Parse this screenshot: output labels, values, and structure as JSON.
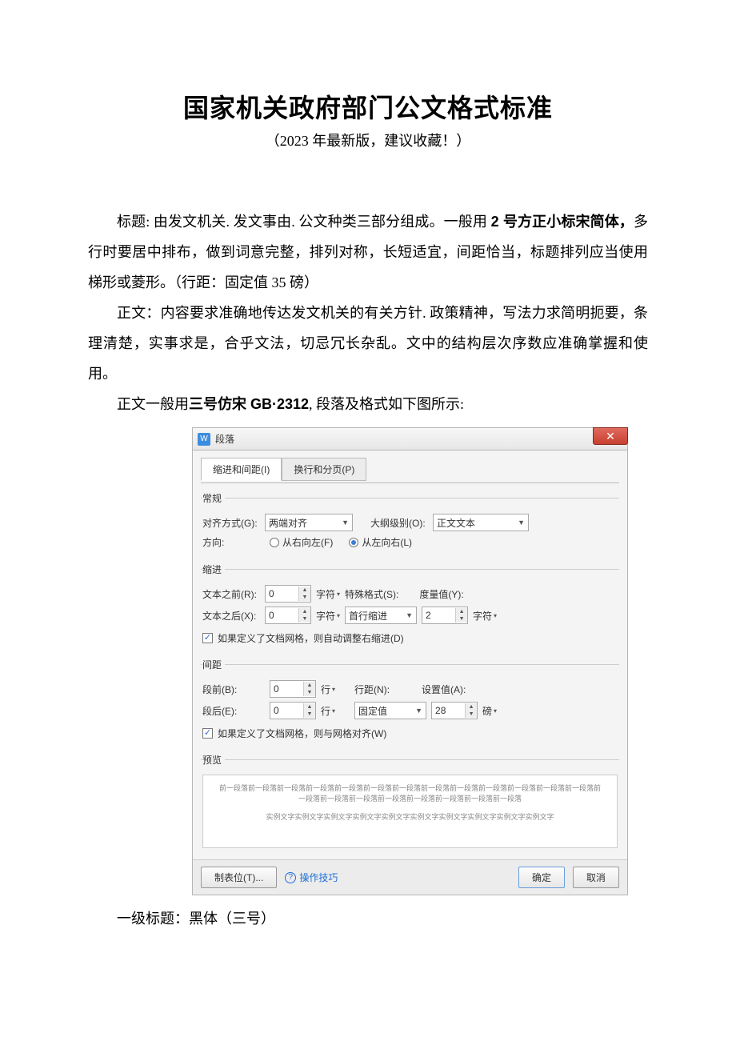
{
  "doc": {
    "title": "国家机关政府部门公文格式标准",
    "subtitle": "（2023 年最新版，建议收藏！）",
    "p1_a": "标题:",
    "p1_b": " 由发文机关. 发文事由. 公文种类三部分组成。一般用 ",
    "p1_bold1": "2 号方正小标宋简体，",
    "p1_c": "多行时要居中排布，做到词意完整，排列对称，长短适宜，间距恰当，标题排列应当使用梯形或菱形。（行距：固定值 35 磅）",
    "p2": "正文：内容要求准确地传达发文机关的有关方针. 政策精神，写法力求简明扼要，条理清楚，实事求是，合乎文法，切忌冗长杂乱。文中的结构层次序数应准确掌握和使用。",
    "p3_a": "正文一般用",
    "p3_bold": "三号仿宋 GB·2312",
    "p3_b": ", 段落及格式如下图所示:",
    "p4": "一级标题：黑体（三号）"
  },
  "dialog": {
    "title": "段落",
    "close": "✕",
    "tabs": {
      "indent": "缩进和间距(I)",
      "pagebreak": "换行和分页(P)"
    },
    "groups": {
      "general": {
        "legend": "常规",
        "align_label": "对齐方式(G):",
        "align_value": "两端对齐",
        "outline_label": "大纲级别(O):",
        "outline_value": "正文文本",
        "dir_label": "方向:",
        "dir_rtl": "从右向左(F)",
        "dir_ltr": "从左向右(L)"
      },
      "indent": {
        "legend": "缩进",
        "before_label": "文本之前(R):",
        "before_value": "0",
        "after_label": "文本之后(X):",
        "after_value": "0",
        "unit_char": "字符",
        "special_label": "特殊格式(S):",
        "special_value": "首行缩进",
        "measure_label": "度量值(Y):",
        "measure_value": "2",
        "chk_grid": "如果定义了文档网格，则自动调整右缩进(D)"
      },
      "spacing": {
        "legend": "间距",
        "before_label": "段前(B):",
        "before_value": "0",
        "after_label": "段后(E):",
        "after_value": "0",
        "unit_line": "行",
        "linespacing_label": "行距(N):",
        "linespacing_value": "固定值",
        "setat_label": "设置值(A):",
        "setat_value": "28",
        "unit_pt": "磅",
        "chk_snap": "如果定义了文档网格，则与网格对齐(W)"
      },
      "preview": {
        "legend": "预览",
        "text1": "前一段落前一段落前一段落前一段落前一段落前一段落前一段落前一段落前一段落前一段落前一段落前一段落前一段落前一段落前一段落前一段落前一段落前一段落前一段落前一段落前一段落",
        "text2": "实例文字实例文字实例文字实例文字实例文字实例文字实例文字实例文字实例文字实例文字"
      }
    },
    "footer": {
      "tabstops": "制表位(T)...",
      "tips": "操作技巧",
      "ok": "确定",
      "cancel": "取消"
    }
  }
}
